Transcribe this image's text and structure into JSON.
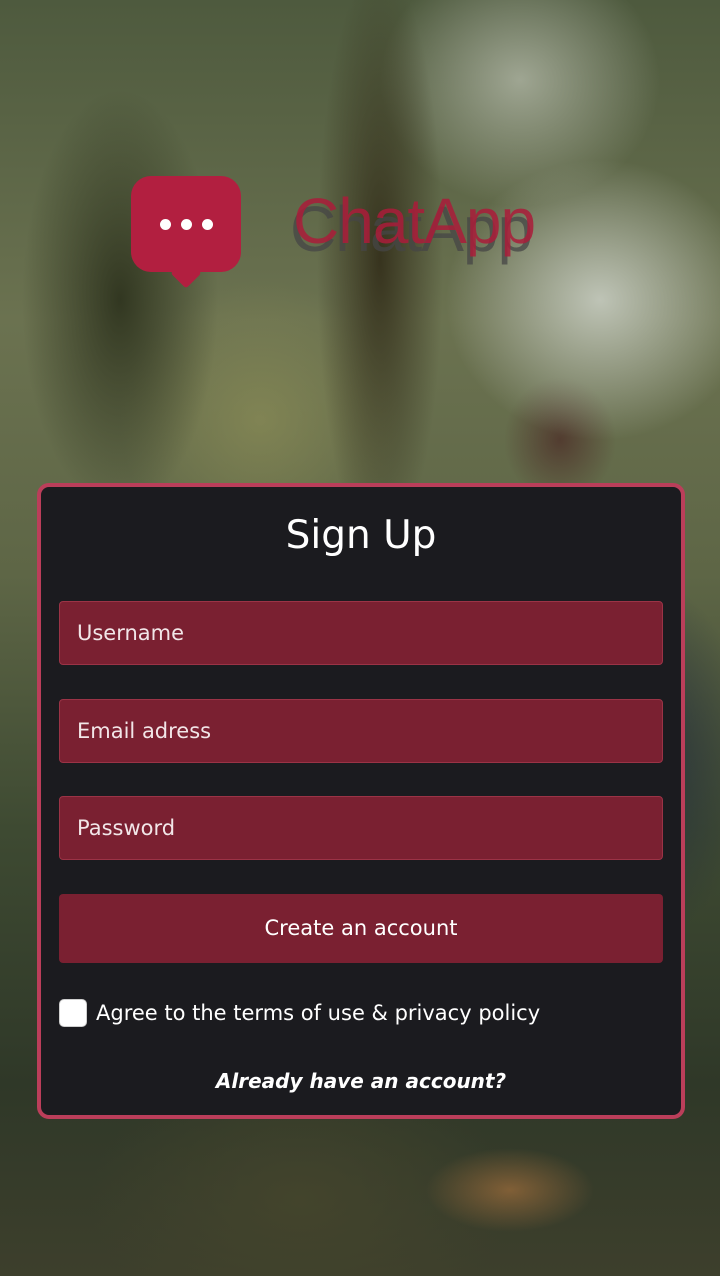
{
  "brand": {
    "name": "ChatApp",
    "icon": "chat-bubble-dots-icon",
    "color": "#b21f40"
  },
  "form": {
    "title": "Sign Up",
    "username_placeholder": "Username",
    "email_placeholder": "Email adress",
    "password_placeholder": "Password",
    "submit_label": "Create an account",
    "terms_label": "Agree to the terms of use & privacy policy",
    "terms_checked": false,
    "login_link": "Already have an account?"
  },
  "colors": {
    "card_background": "#1b1b1f",
    "card_border": "#bb3e5a",
    "field_background": "#7a2031"
  }
}
